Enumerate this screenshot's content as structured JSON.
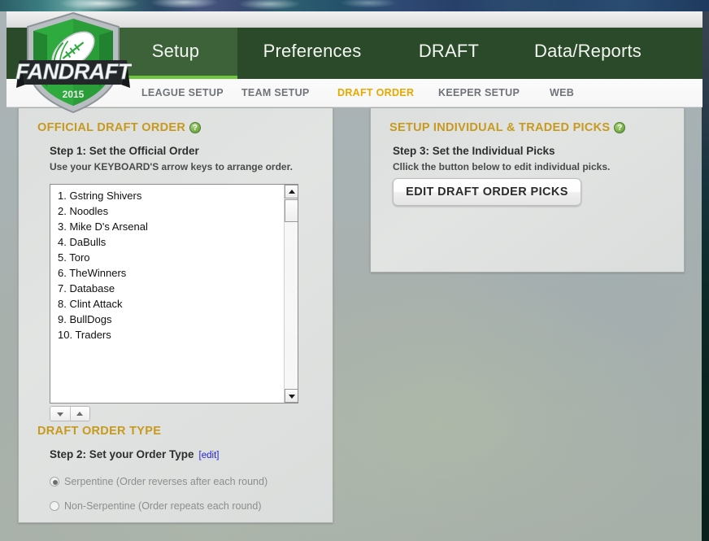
{
  "brand": {
    "logo_name": "FANDRAFT",
    "logo_year": "2015"
  },
  "mainnav": {
    "tabs": [
      {
        "label": "Setup",
        "active": true
      },
      {
        "label": "Preferences",
        "active": false
      },
      {
        "label": "DRAFT",
        "active": false
      },
      {
        "label": "Data/Reports",
        "active": false
      }
    ],
    "active_color": "#6ec63d",
    "bar_color": "#2b4a29"
  },
  "subnav": {
    "items": [
      {
        "label": "LEAGUE SETUP",
        "active": false
      },
      {
        "label": "TEAM SETUP",
        "active": false
      },
      {
        "label": "DRAFT ORDER",
        "active": true
      },
      {
        "label": "KEEPER SETUP",
        "active": false
      },
      {
        "label": "WEB",
        "active": false
      }
    ],
    "active_color": "#e8a800",
    "inactive_color": "#6f7479"
  },
  "official_draft_order": {
    "title": "OFFICIAL DRAFT ORDER",
    "help_glyph": "?",
    "step_title": "Step 1: Set the Official Order",
    "step_sub": "Use your KEYBOARD'S arrow keys to arrange order.",
    "teams": [
      "1. Gstring Shivers",
      "2. Noodles",
      "3. Mike D's Arsenal",
      "4. DaBulls",
      "5. Toro",
      "6. TheWinners",
      "7. Database",
      "8. Clint Attack",
      "9. BullDogs",
      "10. Traders"
    ],
    "move_down_glyph": "▼",
    "move_up_glyph": "▲"
  },
  "draft_order_type": {
    "title": "DRAFT ORDER TYPE",
    "step_title": "Step 2: Set your Order Type",
    "edit_link": "[edit]",
    "options": [
      {
        "label": "Serpentine (Order reverses after each round)",
        "selected": true
      },
      {
        "label": "Non-Serpentine (Order repeats each round)",
        "selected": false
      }
    ]
  },
  "individual_picks": {
    "title": "SETUP INDIVIDUAL & TRADED PICKS",
    "help_glyph": "?",
    "step_title": "Step 3: Set the Individual Picks",
    "step_sub": "Cllick the button below to edit individual picks.",
    "button_label": "EDIT DRAFT ORDER PICKS"
  },
  "colors": {
    "panel_title": "#c79a1e",
    "nav_green": "#2b4a29",
    "accent_green": "#6ec63d",
    "link_blue": "#2222cc"
  }
}
